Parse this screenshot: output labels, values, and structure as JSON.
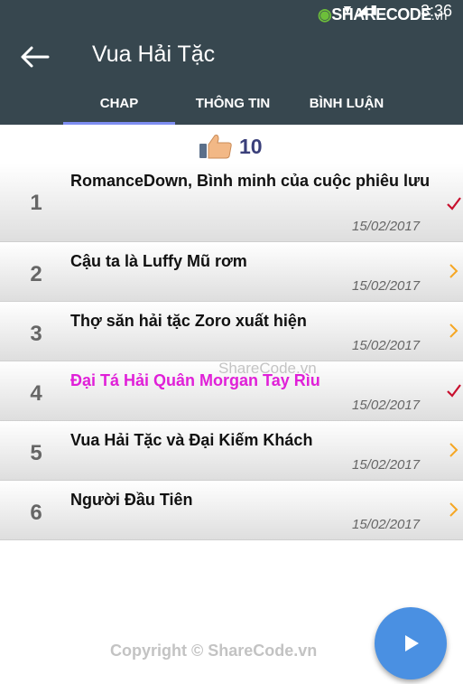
{
  "status_bar": {
    "time": "3:36",
    "brand": "SHARECODE",
    "brand_suffix": ".vn"
  },
  "toolbar": {
    "title": "Vua Hải Tặc"
  },
  "tabs": [
    {
      "label": "CHAP",
      "active": true
    },
    {
      "label": "THÔNG TIN",
      "active": false
    },
    {
      "label": "BÌNH LUẬN",
      "active": false
    }
  ],
  "likes": {
    "count": "10"
  },
  "chapters": [
    {
      "number": "1",
      "title": "RomanceDown, Bình minh của cuộc phiêu lưu",
      "date": "15/02/2017",
      "status": "read"
    },
    {
      "number": "2",
      "title": "Cậu ta là Luffy Mũ rơm",
      "date": "15/02/2017",
      "status": "unread"
    },
    {
      "number": "3",
      "title": "Thợ săn hải tặc Zoro xuất hiện",
      "date": "15/02/2017",
      "status": "unread"
    },
    {
      "number": "4",
      "title": "Đại Tá Hải Quân Morgan Tay Rìu",
      "date": "15/02/2017",
      "status": "current"
    },
    {
      "number": "5",
      "title": "Vua Hải Tặc và Đại Kiếm Khách",
      "date": "15/02/2017",
      "status": "unread"
    },
    {
      "number": "6",
      "title": "Người Đầu Tiên",
      "date": "15/02/2017",
      "status": "unread"
    }
  ],
  "watermarks": {
    "center": "ShareCode.vn",
    "footer": "Copyright © ShareCode.vn"
  },
  "colors": {
    "toolbar": "#37474f",
    "accent": "#4a90e2",
    "active_chapter": "#e020d8",
    "check": "#c8102e",
    "chevron": "#f5a623"
  }
}
